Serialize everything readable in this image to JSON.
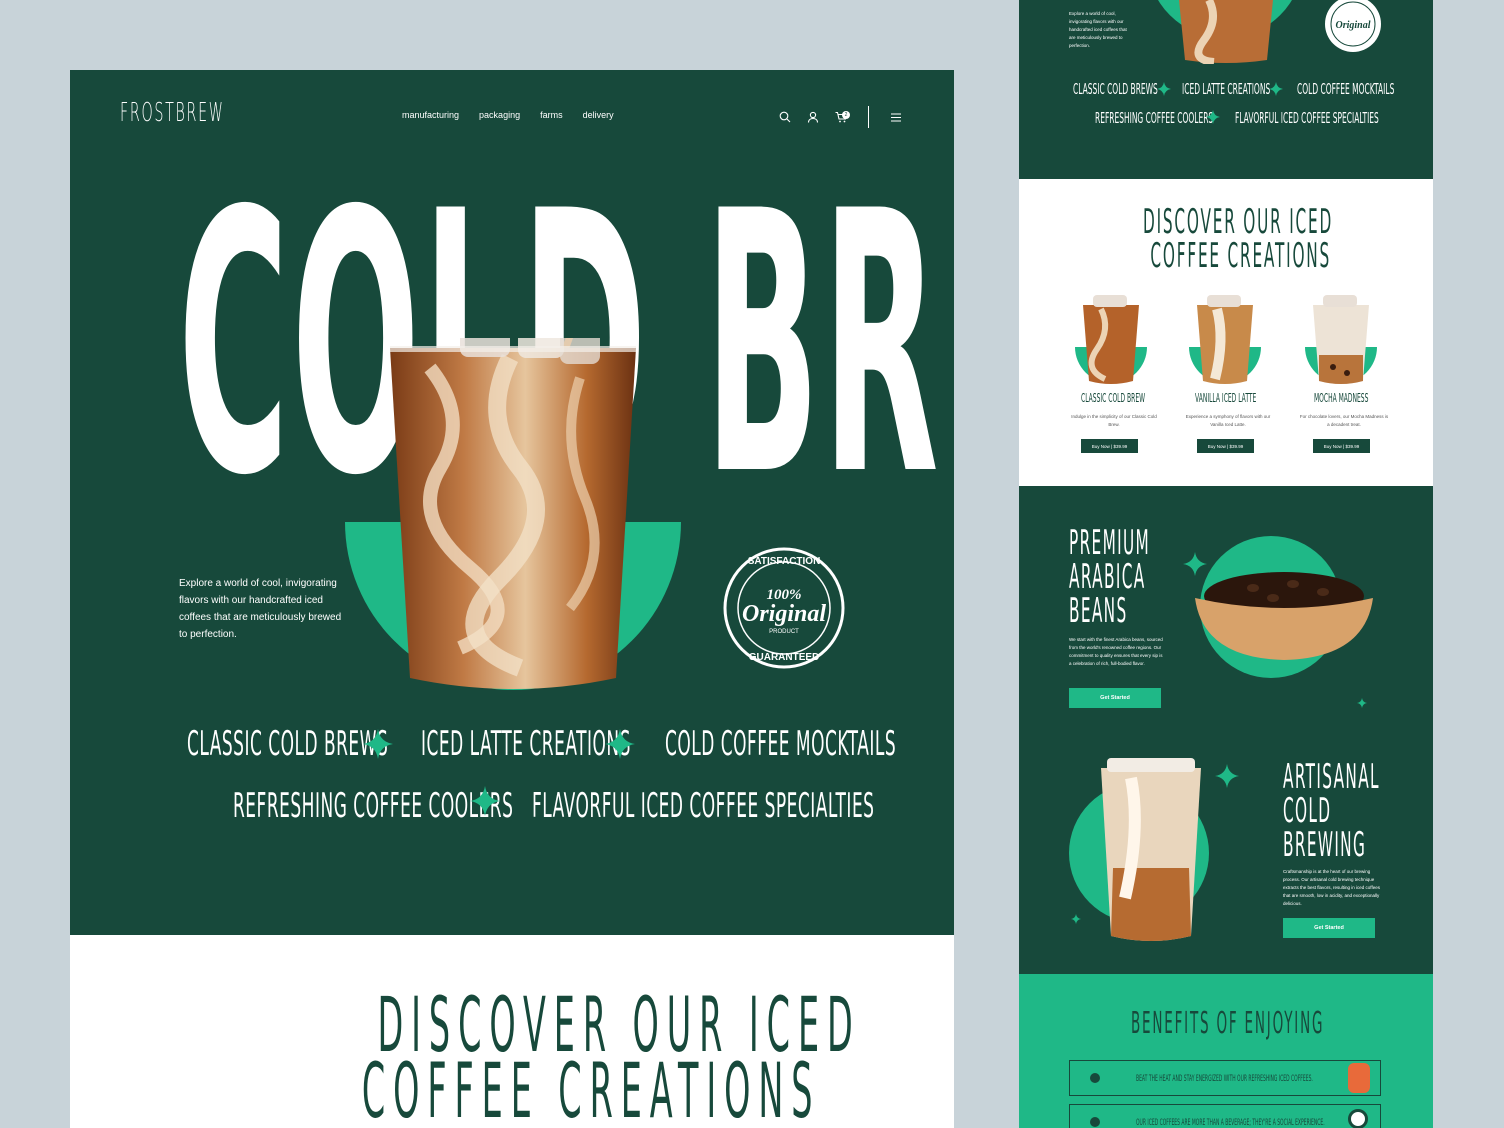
{
  "brand": {
    "logo": "FROSTBREW"
  },
  "colors": {
    "dark_green": "#17493b",
    "mint": "#1fb887",
    "white": "#ffffff",
    "background": "#c8d3d9"
  },
  "nav": {
    "items": [
      "manufacturing",
      "packaging",
      "farms",
      "delivery"
    ]
  },
  "header_icons": {
    "search": "search-icon",
    "account": "user-icon",
    "cart": "cart-icon",
    "cart_count": "2",
    "menu": "menu-icon"
  },
  "hero": {
    "headline": "COLD BREW",
    "description": "Explore a world of cool, invigorating flavors with our handcrafted iced coffees that are meticulously brewed to perfection.",
    "stamp": {
      "top": "SATISFACTION",
      "percent": "100%",
      "word": "Original",
      "product": "PRODUCT",
      "bottom": "GUARANTEED"
    }
  },
  "categories": [
    "CLASSIC COLD BREWS",
    "ICED LATTE CREATIONS",
    "COLD COFFEE MOCKTAILS",
    "REFRESHING COFFEE COOLERS",
    "FLAVORFUL ICED COFFEE SPECIALTIES"
  ],
  "discover": {
    "line1": "DISCOVER OUR ICED",
    "line2": "COFFEE CREATIONS"
  },
  "side": {
    "intro": "Explore a world of cool, invigorating flavors with our handcrafted iced coffees that are meticulously brewed to perfection.",
    "products": [
      {
        "name": "CLASSIC COLD BREW",
        "desc": "Indulge in the simplicity of our Classic Cold Brew.",
        "button": "Buy Now | $39.99"
      },
      {
        "name": "VANILLA ICED LATTE",
        "desc": "Experience a symphony of flavors with our Vanilla Iced Latte.",
        "button": "Buy Now | $39.99"
      },
      {
        "name": "MOCHA MADNESS",
        "desc": "For chocolate lovers, our Mocha Madness is a decadent treat.",
        "button": "Buy Now | $39.99"
      }
    ],
    "premium": {
      "title": [
        "PREMIUM",
        "ARABICA",
        "BEANS"
      ],
      "text": "We start with the finest Arabica beans, sourced from the world's renowned coffee regions. Our commitment to quality ensures that every sip is a celebration of rich, full-bodied flavor.",
      "button": "Get Started"
    },
    "artisanal": {
      "title": [
        "ARTISANAL",
        "COLD",
        "BREWING"
      ],
      "text": "Craftsmanship is at the heart of our brewing process. Our artisanal cold brewing technique extracts the best flavors, resulting in iced coffees that are smooth, low in acidity, and exceptionally delicious.",
      "button": "Get Started"
    },
    "benefits": {
      "title": "BENEFITS OF ENJOYING",
      "items": [
        "BEAT THE HEAT AND STAY ENERGIZED WITH OUR REFRESHING ICED COFFEES.",
        "OUR ICED COFFEES ARE MORE THAN A BEVERAGE; THEY'RE A SOCIAL EXPERIENCE."
      ]
    }
  }
}
